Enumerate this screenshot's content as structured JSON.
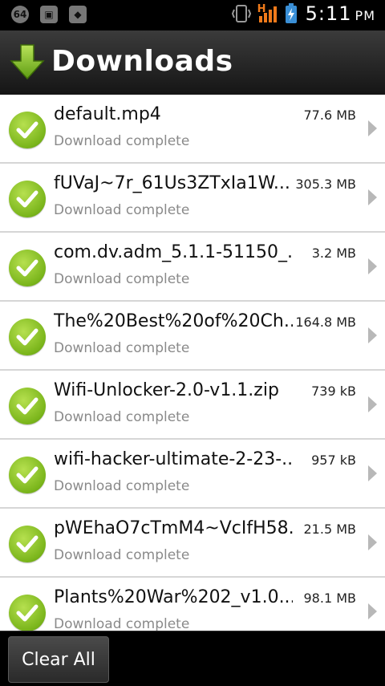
{
  "status_bar": {
    "left_icons": [
      "64-badge-icon",
      "image-icon",
      "app-icon"
    ],
    "network_label": "H",
    "time": "5:11",
    "ampm": "PM"
  },
  "header": {
    "title": "Downloads",
    "icon": "download-arrow-icon"
  },
  "downloads": [
    {
      "name": "default.mp4",
      "size": "77.6 MB",
      "status": "Download complete"
    },
    {
      "name": "fUVaJ~7r_61Us3ZTxIa1W...",
      "size": "305.3 MB",
      "status": "Download complete"
    },
    {
      "name": "com.dv.adm_5.1.1-51150_...",
      "size": "3.2 MB",
      "status": "Download complete"
    },
    {
      "name": "The%20Best%20of%20Ch...",
      "size": "164.8 MB",
      "status": "Download complete"
    },
    {
      "name": "Wifi-Unlocker-2.0-v1.1.zip",
      "size": "739 kB",
      "status": "Download complete"
    },
    {
      "name": "wifi-hacker-ultimate-2-23-...",
      "size": "957 kB",
      "status": "Download complete"
    },
    {
      "name": "pWEhaO7cTmM4~VcIfH58...",
      "size": "21.5 MB",
      "status": "Download complete"
    },
    {
      "name": "Plants%20War%202_v1.0....",
      "size": "98.1 MB",
      "status": "Download complete"
    }
  ],
  "footer": {
    "clear_all_label": "Clear All"
  },
  "colors": {
    "accent_green": "#7ab51b",
    "header_bg": "#2a2a2a",
    "list_bg": "#ffffff"
  }
}
